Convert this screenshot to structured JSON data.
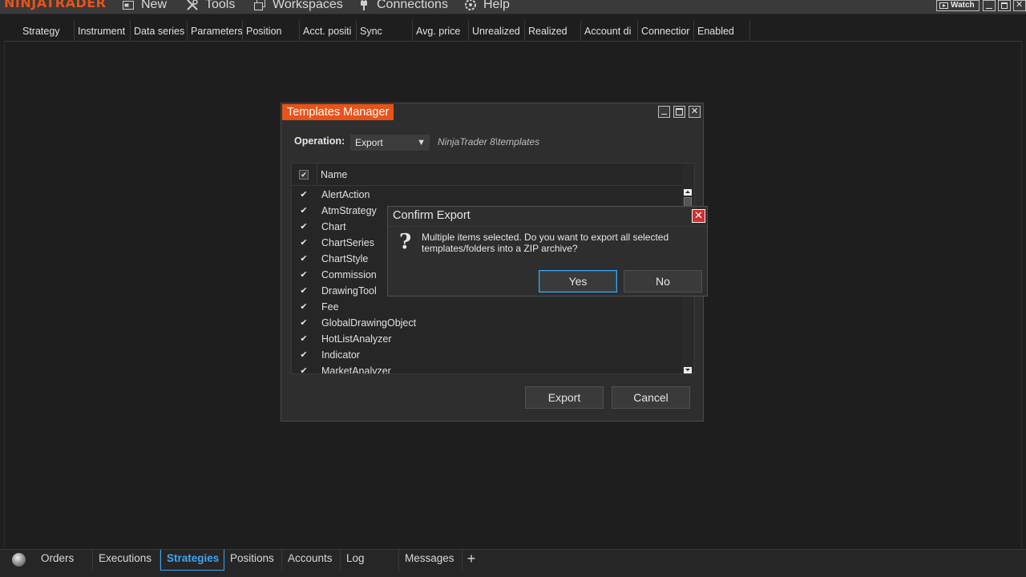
{
  "app": {
    "logo_text": "NINJATRADER",
    "menu": [
      {
        "label": "New",
        "icon": "new-window-icon"
      },
      {
        "label": "Tools",
        "icon": "tools-icon"
      },
      {
        "label": "Workspaces",
        "icon": "workspaces-icon"
      },
      {
        "label": "Connections",
        "icon": "connections-plug-icon"
      },
      {
        "label": "Help",
        "icon": "help-icon"
      }
    ],
    "watch_label": "Watch",
    "accent_color": "#e8531a"
  },
  "strategies_grid": {
    "columns": [
      "Strategy",
      "Instrument",
      "Data series",
      "Parameters",
      "Position",
      "Acct. positi",
      "Sync",
      "Avg. price",
      "Unrealized",
      "Realized",
      "Account di",
      "Connectior",
      "Enabled"
    ]
  },
  "bottom_tabs": {
    "items": [
      "Orders",
      "Executions",
      "Strategies",
      "Positions",
      "Accounts",
      "Log",
      "Messages"
    ],
    "active": "Strategies",
    "add_label": "+"
  },
  "templates_manager": {
    "title": "Templates Manager",
    "operation_label": "Operation:",
    "operation_value": "Export",
    "path": "NinjaTrader 8\\templates",
    "list_header": "Name",
    "items": [
      "AlertAction",
      "AtmStrategy",
      "Chart",
      "ChartSeries",
      "ChartStyle",
      "Commission",
      "DrawingTool",
      "Fee",
      "GlobalDrawingObject",
      "HotListAnalyzer",
      "Indicator",
      "MarketAnalyzer"
    ],
    "check_mark": "✔",
    "export_button": "Export",
    "cancel_button": "Cancel"
  },
  "confirm_export": {
    "title": "Confirm Export",
    "icon_glyph": "?",
    "message": "Multiple items selected. Do you want to export all selected templates/folders into a ZIP archive?",
    "yes_button": "Yes",
    "no_button": "No"
  }
}
